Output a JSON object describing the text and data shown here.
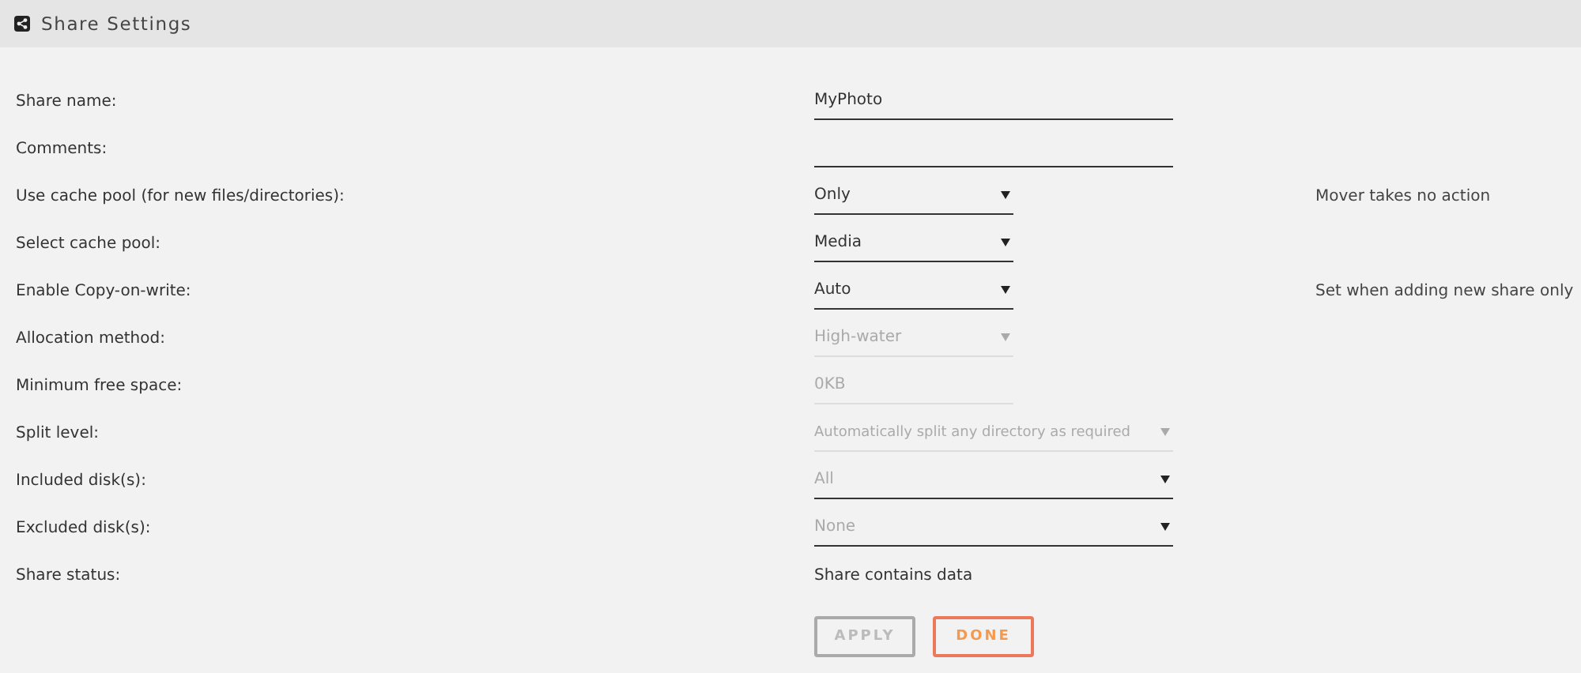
{
  "header": {
    "title": "Share Settings"
  },
  "rows": [
    {
      "label": "Share name:",
      "kind": "text",
      "value": "MyPhoto",
      "disabled": false
    },
    {
      "label": "Comments:",
      "kind": "text",
      "disabled": false
    },
    {
      "label": "Use cache pool (for new files/directories):",
      "kind": "select",
      "value": "Only",
      "disabled": false,
      "note": "Mover takes no action"
    },
    {
      "label": "Select cache pool:",
      "kind": "select",
      "value": "Media",
      "disabled": false
    },
    {
      "label": "Enable Copy-on-write:",
      "kind": "select",
      "value": "Auto",
      "disabled": false,
      "note": "Set when adding new share only"
    },
    {
      "label": "Allocation method:",
      "kind": "select",
      "value": "High-water",
      "disabled": true
    },
    {
      "label": "Minimum free space:",
      "kind": "text",
      "value": "0KB",
      "disabled": true
    },
    {
      "label": "Split level:",
      "kind": "wideselect",
      "value": "Automatically split any directory as required",
      "disabled": true
    },
    {
      "label": "Included disk(s):",
      "kind": "multiselect",
      "value": "All",
      "disabled": false
    },
    {
      "label": "Excluded disk(s):",
      "kind": "multiselect",
      "value": "None",
      "disabled": false
    },
    {
      "label": "Share status:",
      "kind": "static",
      "value": "Share contains data"
    }
  ],
  "buttons": [
    {
      "label": "APPLY",
      "disabled": true
    },
    {
      "label": "DONE",
      "disabled": false
    }
  ]
}
